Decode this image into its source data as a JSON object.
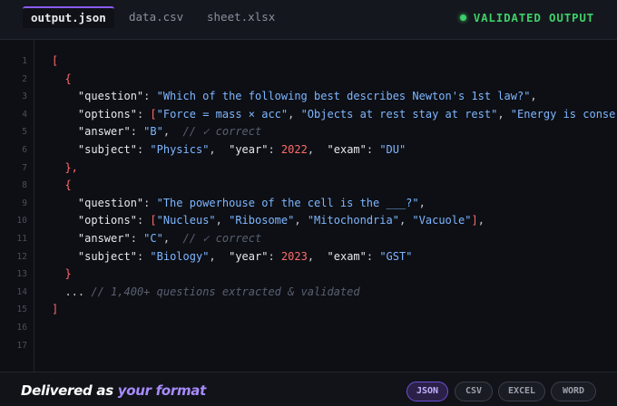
{
  "tabs": [
    {
      "label": "output.json",
      "active": true
    },
    {
      "label": "data.csv",
      "active": false
    },
    {
      "label": "sheet.xlsx",
      "active": false
    }
  ],
  "status": {
    "label": "VALIDATED OUTPUT",
    "color": "#3ecf68"
  },
  "line_numbers": [
    "1",
    "2",
    "3",
    "4",
    "5",
    "6",
    "7",
    "8",
    "9",
    "10",
    "11",
    "12",
    "13",
    "14",
    "15",
    "16",
    "17"
  ],
  "code": {
    "l1_open": "[",
    "l2_brace": "{",
    "l3_key": "\"question\"",
    "l3_val": "\"Which of the following best describes Newton's 1st law?\"",
    "l4_key": "\"options\"",
    "l4_o1": "\"Force = mass × acc\"",
    "l4_o2": "\"Objects at rest stay at rest\"",
    "l4_o3": "\"Energy is conserved\"",
    "l4_o4": "\"",
    "l5_key": "\"answer\"",
    "l5_val": "\"B\"",
    "l5_comment": "// ✓ correct",
    "l6_k1": "\"subject\"",
    "l6_v1": "\"Physics\"",
    "l6_k2": "\"year\"",
    "l6_v2": "2022",
    "l6_k3": "\"exam\"",
    "l6_v3": "\"DU\"",
    "l7_close": "},",
    "l8_brace": "{",
    "l9_key": "\"question\"",
    "l9_val": "\"The powerhouse of the cell is the ___?\"",
    "l10_key": "\"options\"",
    "l10_o1": "\"Nucleus\"",
    "l10_o2": "\"Ribosome\"",
    "l10_o3": "\"Mitochondria\"",
    "l10_o4": "\"Vacuole\"",
    "l11_key": "\"answer\"",
    "l11_val": "\"C\"",
    "l11_comment": "// ✓ correct",
    "l12_k1": "\"subject\"",
    "l12_v1": "\"Biology\"",
    "l12_k2": "\"year\"",
    "l12_v2": "2023",
    "l12_k3": "\"exam\"",
    "l12_v3": "\"GST\"",
    "l13_close": "}",
    "l14_ellipsis": "...",
    "l14_comment": "// 1,400+ questions extracted & validated",
    "l15_close": "]"
  },
  "footer": {
    "tagline_prefix": "Delivered as ",
    "tagline_accent": "your format",
    "formats": [
      {
        "label": "JSON",
        "active": true
      },
      {
        "label": "CSV",
        "active": false
      },
      {
        "label": "EXCEL",
        "active": false
      },
      {
        "label": "WORD",
        "active": false
      }
    ]
  },
  "colors": {
    "accent": "#8b5cf6",
    "string": "#7eb6ff",
    "number": "#ff6b6b",
    "bracket": "#ff6b6b",
    "comment": "#596070",
    "success": "#3ecf68"
  }
}
